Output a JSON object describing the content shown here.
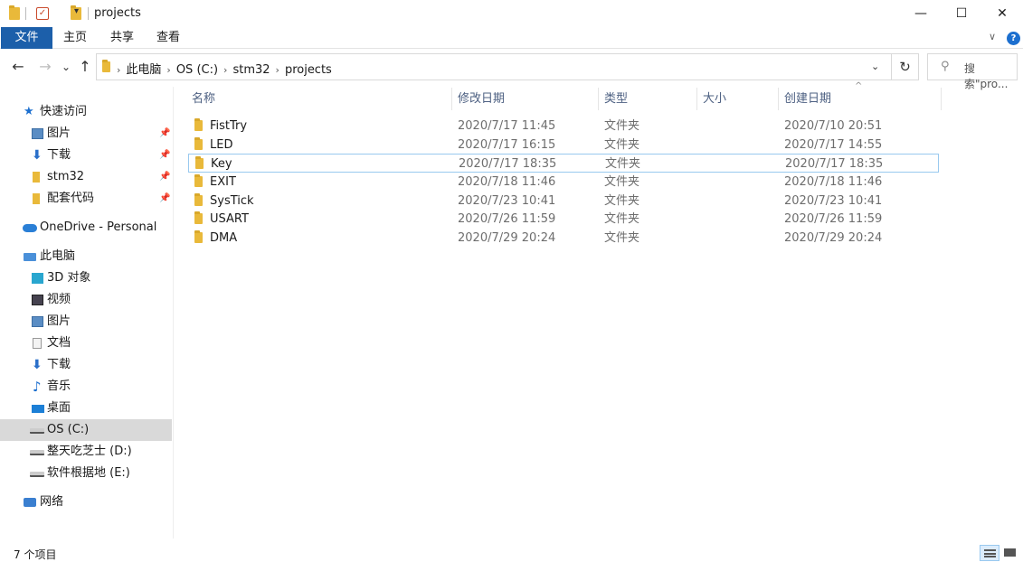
{
  "window": {
    "title": "projects",
    "minimize_glyph": "—",
    "maximize_glyph": "☐",
    "close_glyph": "✕"
  },
  "ribbon": {
    "tabs": [
      "文件",
      "主页",
      "共享",
      "查看"
    ],
    "collapse_glyph": "∨",
    "help_glyph": "?"
  },
  "address": {
    "crumbs": [
      "此电脑",
      "OS (C:)",
      "stm32",
      "projects"
    ],
    "back_glyph": "←",
    "forward_glyph": "→",
    "recent_glyph": "⌄",
    "up_glyph": "↑",
    "dropdown_glyph": "⌄",
    "refresh_glyph": "↻"
  },
  "search": {
    "placeholder": "搜索\"pro..."
  },
  "nav": {
    "quick_access": "快速访问",
    "quick_items": [
      "图片",
      "下载",
      "stm32",
      "配套代码"
    ],
    "onedrive": "OneDrive - Personal",
    "this_pc": "此电脑",
    "pc_items": [
      "3D 对象",
      "视频",
      "图片",
      "文档",
      "下载",
      "音乐",
      "桌面",
      "OS (C:)",
      "整天吃芝士 (D:)",
      "软件根据地 (E:)"
    ],
    "network": "网络",
    "selected": "OS (C:)"
  },
  "columns": {
    "name": "名称",
    "modified": "修改日期",
    "type": "类型",
    "size": "大小",
    "created": "创建日期"
  },
  "files": [
    {
      "name": "FistTry",
      "modified": "2020/7/17 11:45",
      "type": "文件夹",
      "created": "2020/7/10 20:51"
    },
    {
      "name": "LED",
      "modified": "2020/7/17 16:15",
      "type": "文件夹",
      "created": "2020/7/17 14:55"
    },
    {
      "name": "Key",
      "modified": "2020/7/17 18:35",
      "type": "文件夹",
      "created": "2020/7/17 18:35"
    },
    {
      "name": "EXIT",
      "modified": "2020/7/18 11:46",
      "type": "文件夹",
      "created": "2020/7/18 11:46"
    },
    {
      "name": "SysTick",
      "modified": "2020/7/23 10:41",
      "type": "文件夹",
      "created": "2020/7/23 10:41"
    },
    {
      "name": "USART",
      "modified": "2020/7/26 11:59",
      "type": "文件夹",
      "created": "2020/7/26 11:59"
    },
    {
      "name": "DMA",
      "modified": "2020/7/29 20:24",
      "type": "文件夹",
      "created": "2020/7/29 20:24"
    }
  ],
  "status": {
    "count_text": "7 个项目"
  },
  "colors": {
    "file_tab": "#1c5faa",
    "selected_nav": "#d9d9d9",
    "focus_border": "#99c9ef",
    "header_text": "#4d6082"
  }
}
